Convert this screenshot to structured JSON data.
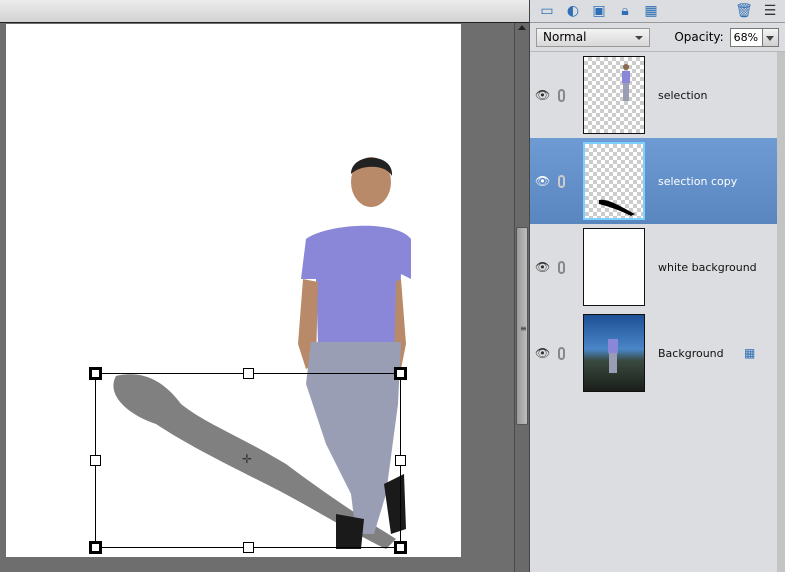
{
  "toolbar": {
    "icons": [
      "new-layer-icon",
      "adjustment-layer-icon",
      "layer-mask-icon",
      "lock-all-icon",
      "lock-transparency-icon",
      "trash-icon",
      "panel-menu-icon"
    ]
  },
  "blend_mode": "Normal",
  "opacity": {
    "label": "Opacity:",
    "value": "68%"
  },
  "layers": [
    {
      "name": "selection",
      "selected": false,
      "thumb": "person"
    },
    {
      "name": "selection copy",
      "selected": true,
      "thumb": "shadow"
    },
    {
      "name": "white background",
      "selected": false,
      "thumb": "white"
    },
    {
      "name": "Background",
      "selected": false,
      "thumb": "photo",
      "locked": true
    }
  ]
}
